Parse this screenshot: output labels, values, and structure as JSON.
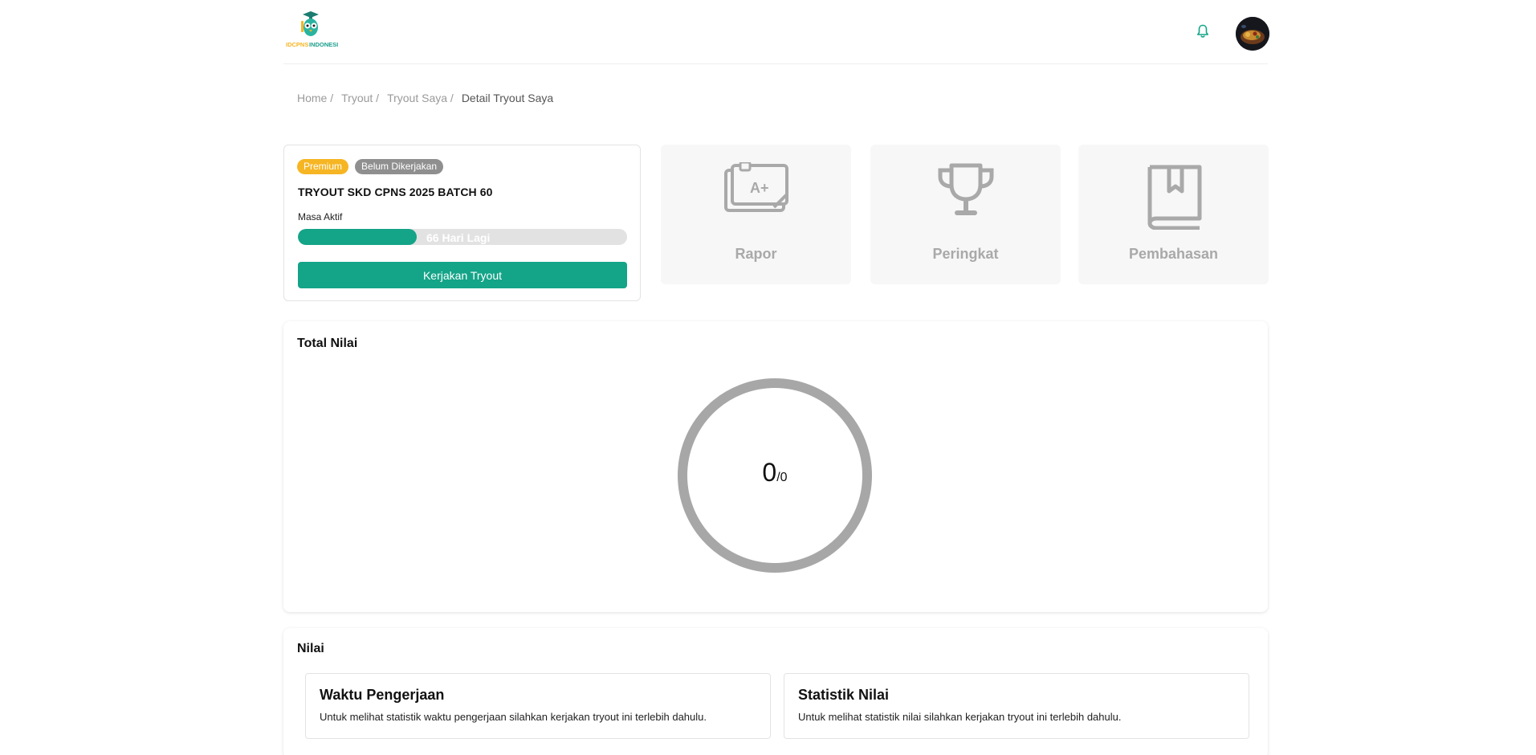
{
  "header": {
    "logo_text": "IDCPNS INDONESIA",
    "colors": {
      "accent": "#14a488"
    }
  },
  "breadcrumb": {
    "items": [
      "Home /",
      "Tryout /",
      "Tryout Saya /"
    ],
    "current": "Detail Tryout Saya"
  },
  "tryout": {
    "badges": {
      "premium": "Premium",
      "status": "Belum Dikerjakan"
    },
    "title": "TRYOUT SKD CPNS 2025 BATCH 60",
    "masa_aktif_label": "Masa Aktif",
    "remaining_text": "66 Hari Lagi",
    "remaining_fraction": 0.36,
    "start_button": "Kerjakan Tryout"
  },
  "menu_tiles": [
    {
      "label": "Rapor",
      "icon": "report-card-icon"
    },
    {
      "label": "Peringkat",
      "icon": "trophy-icon"
    },
    {
      "label": "Pembahasan",
      "icon": "book-bookmark-icon"
    }
  ],
  "total_nilai": {
    "title": "Total Nilai",
    "score": "0",
    "max": "/0"
  },
  "nilai": {
    "title": "Nilai",
    "cards": [
      {
        "title": "Waktu Pengerjaan",
        "desc": "Untuk melihat statistik waktu pengerjaan silahkan kerjakan tryout ini terlebih dahulu."
      },
      {
        "title": "Statistik Nilai",
        "desc": "Untuk melihat statistik nilai silahkan kerjakan tryout ini terlebih dahulu."
      }
    ]
  }
}
